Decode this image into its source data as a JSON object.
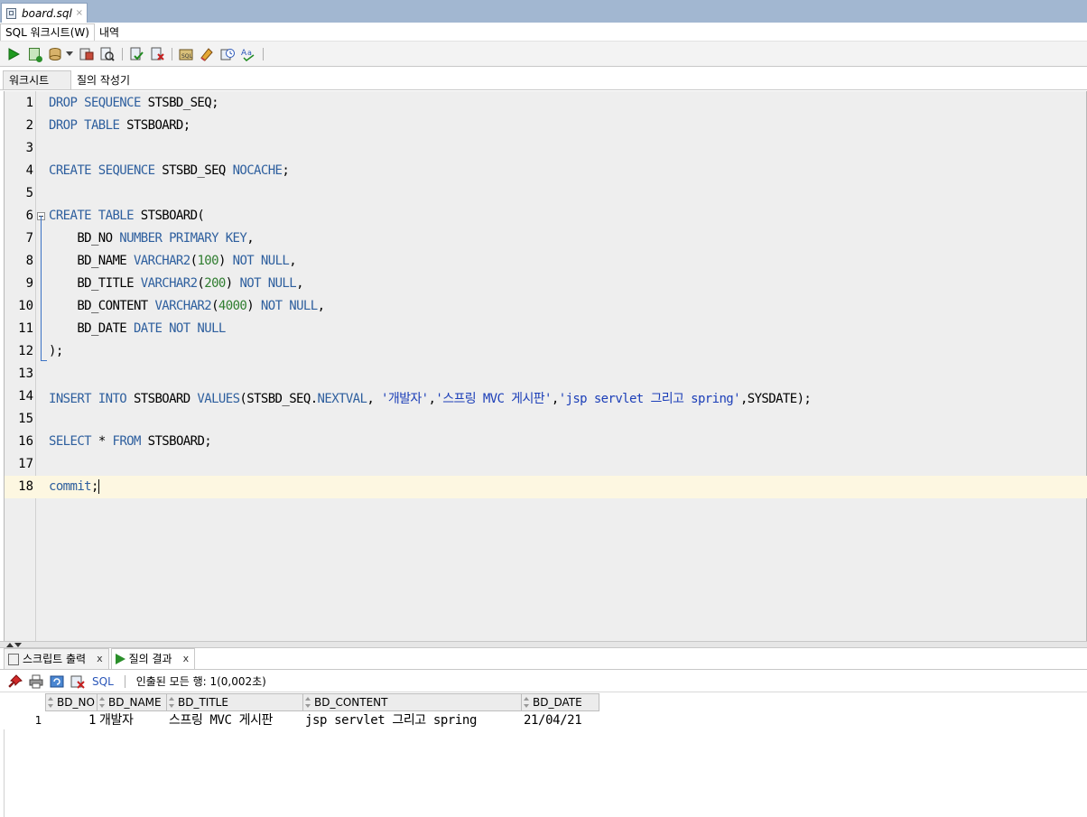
{
  "file_tab": {
    "name": "board.sql",
    "close": "×"
  },
  "sub_tabs": [
    "SQL 워크시트(W)",
    "내역"
  ],
  "ws_tabs": [
    "워크시트",
    "질의 작성기"
  ],
  "editor": {
    "lines": [
      {
        "num": "1",
        "html": "<span class='kw'>DROP SEQUENCE</span> STSBD_SEQ;"
      },
      {
        "num": "2",
        "html": "<span class='kw'>DROP TABLE</span> STSBOARD;"
      },
      {
        "num": "3",
        "html": ""
      },
      {
        "num": "4",
        "html": "<span class='kw'>CREATE SEQUENCE</span> STSBD_SEQ <span class='kw'>NOCACHE</span>;"
      },
      {
        "num": "5",
        "html": ""
      },
      {
        "num": "6",
        "html": "<span class='kw'>CREATE TABLE</span> STSBOARD("
      },
      {
        "num": "7",
        "html": "    BD_NO <span class='kw'>NUMBER PRIMARY KEY</span>,"
      },
      {
        "num": "8",
        "html": "    BD_NAME <span class='kw'>VARCHAR2</span>(<span class='num'>100</span>) <span class='kw'>NOT NULL</span>,"
      },
      {
        "num": "9",
        "html": "    BD_TITLE <span class='kw'>VARCHAR2</span>(<span class='num'>200</span>) <span class='kw'>NOT NULL</span>,"
      },
      {
        "num": "10",
        "html": "    BD_CONTENT <span class='kw'>VARCHAR2</span>(<span class='num'>4000</span>) <span class='kw'>NOT NULL</span>,"
      },
      {
        "num": "11",
        "html": "    BD_DATE <span class='kw'>DATE NOT NULL</span>"
      },
      {
        "num": "12",
        "html": ");"
      },
      {
        "num": "13",
        "html": ""
      },
      {
        "num": "14",
        "html": "<span class='kw'>INSERT INTO</span> STSBOARD <span class='kw'>VALUES</span>(STSBD_SEQ.<span class='kw'>NEXTVAL</span>, <span class='str'>'개발자'</span>,<span class='str'>'스프링 MVC 게시판'</span>,<span class='str'>'jsp servlet 그리고 spring'</span>,SYSDATE);"
      },
      {
        "num": "15",
        "html": ""
      },
      {
        "num": "16",
        "html": "<span class='kw'>SELECT</span> * <span class='kw'>FROM</span> STSBOARD;"
      },
      {
        "num": "17",
        "html": ""
      },
      {
        "num": "18",
        "html": "<span class='kw'>commit</span>;"
      }
    ]
  },
  "result_tabs": {
    "script_output": "스크립트 출력",
    "query_result": "질의 결과",
    "close": "x"
  },
  "result_toolbar": {
    "sql_label": "SQL",
    "fetched_text": "인출된 모든 행: 1(0,002초)"
  },
  "grid": {
    "columns": [
      "BD_NO",
      "BD_NAME",
      "BD_TITLE",
      "BD_CONTENT",
      "BD_DATE"
    ],
    "rows": [
      {
        "rownum": "1",
        "cells": [
          "1",
          "개발자",
          "스프링 MVC 게시판",
          "jsp servlet 그리고 spring",
          "21/04/21"
        ]
      }
    ]
  },
  "colors": {
    "keyword": "#2e5f9e",
    "number": "#2f7d2f",
    "string": "#1c3fb8",
    "editor_bg": "#eeeeee",
    "current_line": "#fdf7e1",
    "tab_strip": "#a2b7d1"
  }
}
